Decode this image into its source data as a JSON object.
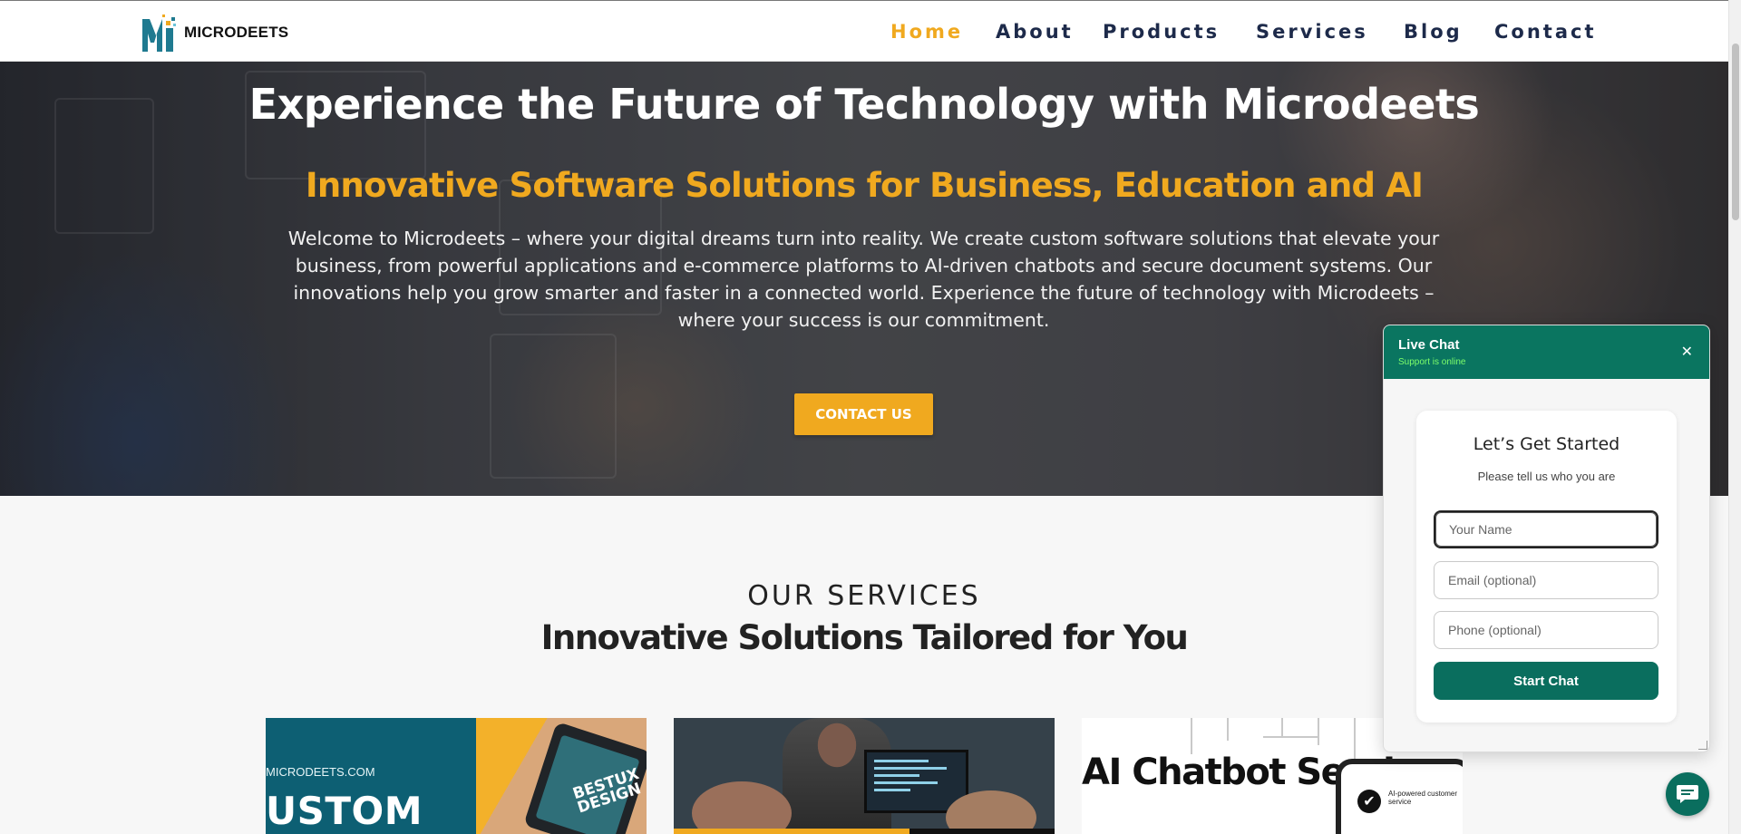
{
  "brand": {
    "name": "MICRODEETS",
    "logo_icon": "microdeets-logo-icon"
  },
  "nav": {
    "items": [
      {
        "label": "Home",
        "active": true
      },
      {
        "label": "About",
        "active": false
      },
      {
        "label": "Products",
        "active": false
      },
      {
        "label": "Services",
        "active": false
      },
      {
        "label": "Blog",
        "active": false
      },
      {
        "label": "Contact",
        "active": false
      }
    ]
  },
  "hero": {
    "title": "Experience the Future of Technology with Microdeets",
    "subtitle": "Innovative Software Solutions for Business, Education and AI",
    "body": "Welcome to Microdeets – where your digital dreams turn into reality. We create custom software solutions that elevate your business, from powerful applications and e-commerce platforms to AI-driven chatbots and secure document systems. Our innovations help you grow smarter and faster in a connected world. Experience the future of technology with Microdeets – where your success is our commitment.",
    "cta_label": "CONTACT US"
  },
  "services": {
    "eyebrow": "OUR SERVICES",
    "heading": "Innovative Solutions Tailored for You",
    "cards": [
      {
        "site": "MICRODEETS.COM",
        "headline": "USTOM",
        "badge": "BESTUX DESIGN"
      },
      {
        "caption": ""
      },
      {
        "headline": "AI Chatbot Services",
        "feature": "AI-powered customer service"
      }
    ]
  },
  "chat": {
    "title": "Live Chat",
    "status": "Support is online",
    "close_icon": "close-icon",
    "card_title": "Let’s Get Started",
    "card_subtitle": "Please tell us who you are",
    "name_placeholder": "Your Name",
    "email_placeholder": "Email (optional)",
    "phone_placeholder": "Phone (optional)",
    "start_label": "Start Chat",
    "fab_icon": "chat-bubble-icon"
  },
  "colors": {
    "accent": "#f0a91f",
    "nav_text": "#1d2a4a",
    "chat_green": "#0a7560",
    "status_green": "#7dff6b"
  }
}
